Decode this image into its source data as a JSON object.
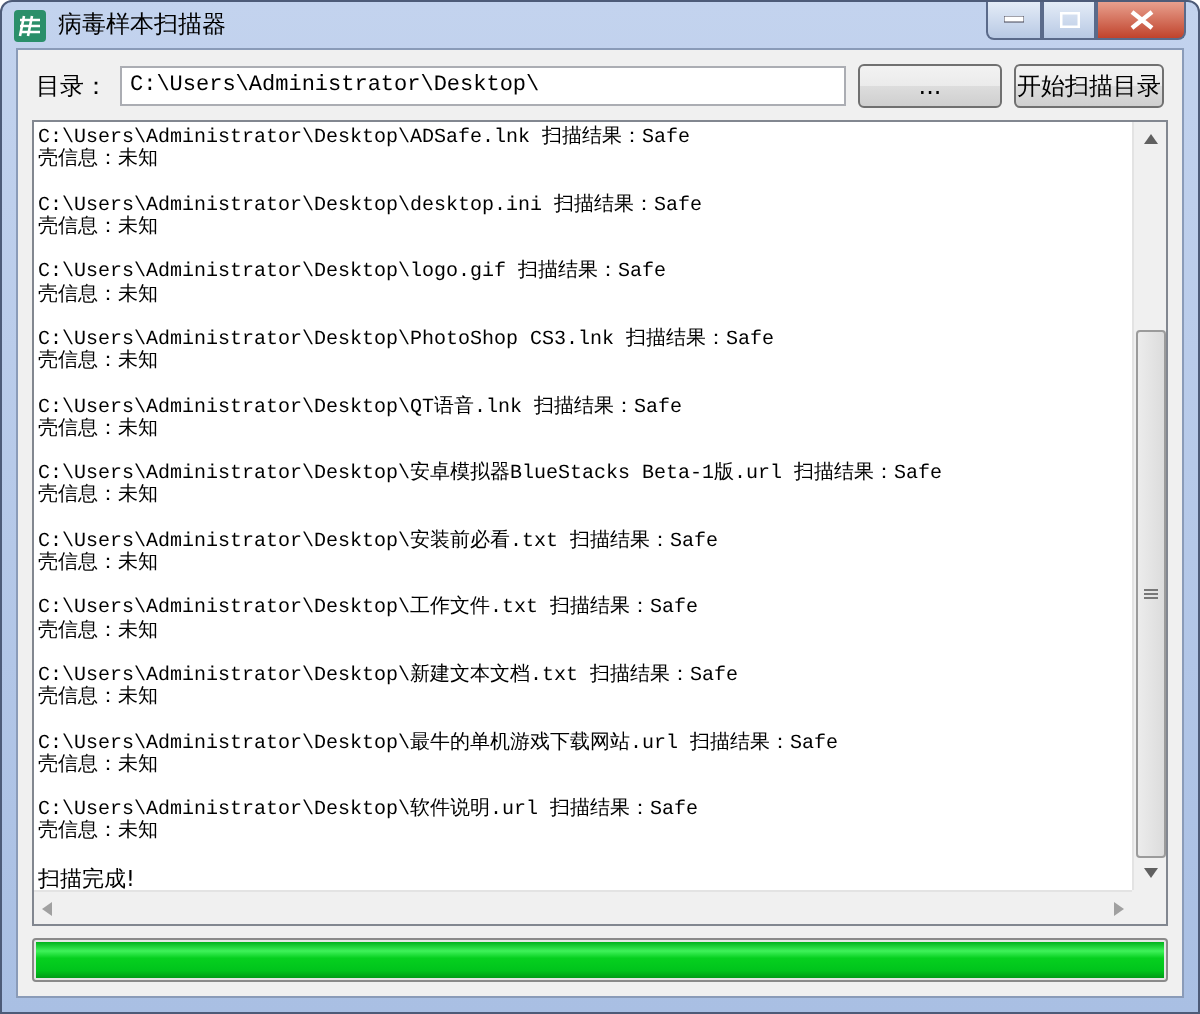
{
  "window": {
    "title": "病毒样本扫描器"
  },
  "directory": {
    "label": "目录：",
    "value": "C:\\Users\\Administrator\\Desktop\\"
  },
  "buttons": {
    "browse": "...",
    "scan": "开始扫描目录"
  },
  "log": {
    "entries": [
      {
        "result": "C:\\Users\\Administrator\\Desktop\\ADSafe.lnk 扫描结果：Safe",
        "shell": "壳信息：未知"
      },
      {
        "result": "C:\\Users\\Administrator\\Desktop\\desktop.ini 扫描结果：Safe",
        "shell": "壳信息：未知"
      },
      {
        "result": "C:\\Users\\Administrator\\Desktop\\logo.gif 扫描结果：Safe",
        "shell": "壳信息：未知"
      },
      {
        "result": "C:\\Users\\Administrator\\Desktop\\PhotoShop CS3.lnk 扫描结果：Safe",
        "shell": "壳信息：未知"
      },
      {
        "result": "C:\\Users\\Administrator\\Desktop\\QT语音.lnk 扫描结果：Safe",
        "shell": "壳信息：未知"
      },
      {
        "result": "C:\\Users\\Administrator\\Desktop\\安卓模拟器BlueStacks Beta-1版.url 扫描结果：Safe",
        "shell": "壳信息：未知"
      },
      {
        "result": "C:\\Users\\Administrator\\Desktop\\安装前必看.txt 扫描结果：Safe",
        "shell": "壳信息：未知"
      },
      {
        "result": "C:\\Users\\Administrator\\Desktop\\工作文件.txt 扫描结果：Safe",
        "shell": "壳信息：未知"
      },
      {
        "result": "C:\\Users\\Administrator\\Desktop\\新建文本文档.txt 扫描结果：Safe",
        "shell": "壳信息：未知"
      },
      {
        "result": "C:\\Users\\Administrator\\Desktop\\最牛的单机游戏下载网站.url 扫描结果：Safe",
        "shell": "壳信息：未知"
      },
      {
        "result": "C:\\Users\\Administrator\\Desktop\\软件说明.url 扫描结果：Safe",
        "shell": "壳信息：未知"
      }
    ],
    "done": "扫描完成!"
  },
  "progress": {
    "level": 1
  }
}
